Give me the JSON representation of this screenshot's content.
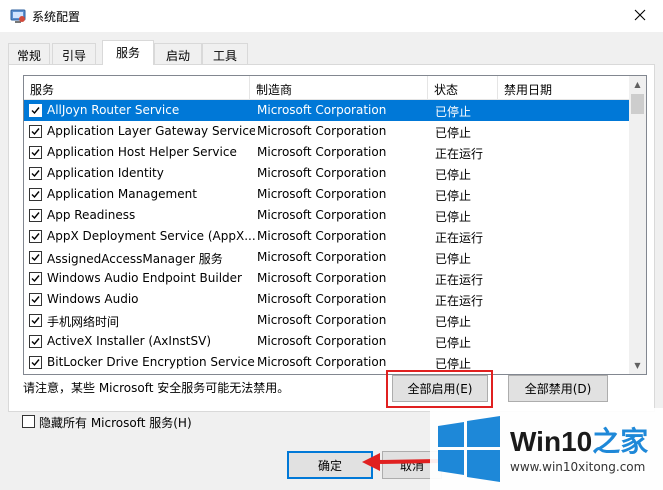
{
  "window": {
    "title": "系统配置"
  },
  "tabs": [
    {
      "label": "常规"
    },
    {
      "label": "引导"
    },
    {
      "label": "服务"
    },
    {
      "label": "启动"
    },
    {
      "label": "工具"
    }
  ],
  "columns": [
    "服务",
    "制造商",
    "状态",
    "禁用日期"
  ],
  "services": [
    {
      "name": "AllJoyn Router Service",
      "maker": "Microsoft Corporation",
      "status": "已停止",
      "date": ""
    },
    {
      "name": "Application Layer Gateway Service",
      "maker": "Microsoft Corporation",
      "status": "已停止",
      "date": ""
    },
    {
      "name": "Application Host Helper Service",
      "maker": "Microsoft Corporation",
      "status": "正在运行",
      "date": ""
    },
    {
      "name": "Application Identity",
      "maker": "Microsoft Corporation",
      "status": "已停止",
      "date": ""
    },
    {
      "name": "Application Management",
      "maker": "Microsoft Corporation",
      "status": "已停止",
      "date": ""
    },
    {
      "name": "App Readiness",
      "maker": "Microsoft Corporation",
      "status": "已停止",
      "date": ""
    },
    {
      "name": "AppX Deployment Service (AppX...",
      "maker": "Microsoft Corporation",
      "status": "正在运行",
      "date": ""
    },
    {
      "name": "AssignedAccessManager 服务",
      "maker": "Microsoft Corporation",
      "status": "已停止",
      "date": ""
    },
    {
      "name": "Windows Audio Endpoint Builder",
      "maker": "Microsoft Corporation",
      "status": "正在运行",
      "date": ""
    },
    {
      "name": "Windows Audio",
      "maker": "Microsoft Corporation",
      "status": "正在运行",
      "date": ""
    },
    {
      "name": "手机网络时间",
      "maker": "Microsoft Corporation",
      "status": "已停止",
      "date": ""
    },
    {
      "name": "ActiveX Installer (AxInstSV)",
      "maker": "Microsoft Corporation",
      "status": "已停止",
      "date": ""
    },
    {
      "name": "BitLocker Drive Encryption Service",
      "maker": "Microsoft Corporation",
      "status": "已停止",
      "date": ""
    }
  ],
  "note": "请注意，某些 Microsoft 安全服务可能无法禁用。",
  "buttons": {
    "enable_all": "全部启用(E)",
    "disable_all": "全部禁用(D)",
    "ok": "确定",
    "cancel": "取消"
  },
  "hide_ms": {
    "label": "隐藏所有 Microsoft 服务(H)",
    "checked": false
  },
  "watermark": {
    "title_main": "Win10",
    "title_accent": "之家",
    "url": "www.win10xitong.com"
  },
  "colors": {
    "selection": "#0078d7",
    "highlight_box": "#e02020",
    "arrow": "#e02020",
    "accent": "#1e88d8"
  }
}
